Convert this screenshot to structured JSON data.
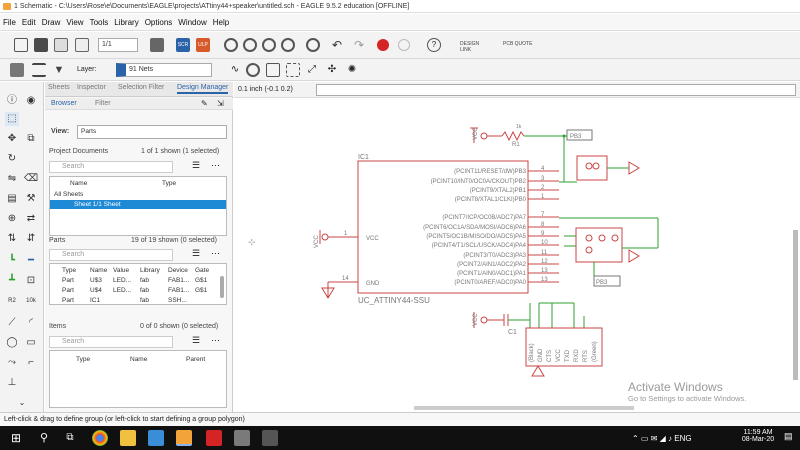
{
  "window": {
    "title": "1 Schematic - C:\\Users\\Rose\\e\\Documents\\EAGLE\\projects\\ATtiny44+speaker\\untitled.sch - EAGLE 9.5.2 education [OFFLINE]"
  },
  "menu": [
    "File",
    "Edit",
    "Draw",
    "View",
    "Tools",
    "Library",
    "Options",
    "Window",
    "Help"
  ],
  "toolbar": {
    "sheet_select": "1/1",
    "scr_label": "SCR",
    "ulp_label": "ULP",
    "design_link_label": "DESIGN LINK",
    "pcb_quote_label": "PCB QUOTE",
    "layer_label": "Layer:",
    "layer_value": "91 Nets"
  },
  "panel": {
    "tabs": [
      "Sheets",
      "Inspector",
      "Selection Filter",
      "Design Manager"
    ],
    "subtabs": [
      "Browser",
      "Filter"
    ],
    "view_label": "View:",
    "view_value": "Parts",
    "project_docs": {
      "title": "Project Documents",
      "count": "1 of 1 shown (1 selected)",
      "search_placeholder": "Search",
      "columns": [
        "Name",
        "Type"
      ],
      "items": [
        "All Sheets",
        "Sheet 1/1 Sheet"
      ]
    },
    "parts": {
      "title": "Parts",
      "count": "19 of 19 shown (0 selected)",
      "search_placeholder": "Search",
      "columns": [
        "Type",
        "Name",
        "Value",
        "Library",
        "Device",
        "Gate"
      ],
      "rows": [
        [
          "Part",
          "U$3",
          "LED...",
          "fab",
          "FAB1...",
          "G$1"
        ],
        [
          "Part",
          "U$4",
          "LED...",
          "fab",
          "FAB1...",
          "G$1"
        ],
        [
          "Part",
          "IC1",
          "",
          "fab",
          "SSH...",
          ""
        ]
      ]
    },
    "items": {
      "title": "Items",
      "count": "0 of 0 shown (0 selected)",
      "search_placeholder": "Search",
      "columns": [
        "Type",
        "Name",
        "Parent"
      ]
    }
  },
  "command": {
    "coords": "0.1 inch (-0.1 0.2)"
  },
  "schematic": {
    "r1": {
      "name": "R1",
      "value": "1k"
    },
    "ic_name": "IC1",
    "ic_value": "UC_ATTINY44-SSU",
    "vcc": "VCC",
    "gnd": "GND",
    "c1": "C1",
    "pb3": "PB3",
    "pins_left": [
      "1",
      "14"
    ],
    "pins_left_names": [
      "VCC",
      "GND"
    ],
    "pins_right": [
      {
        "num": "4",
        "label": "(PCINT11/RESET/dW)PB3"
      },
      {
        "num": "3",
        "label": "(PCINT10/INT0/OC0A/CKOUT)PB2"
      },
      {
        "num": "2",
        "label": "(PCINT9/XTAL2)PB1"
      },
      {
        "num": "1",
        "label": "(PCINT8/XTAL1/CLKI)PB0"
      },
      {
        "num": "7",
        "label": "(PCINT7/ICP/OC0B/ADC7)PA7"
      },
      {
        "num": "8",
        "label": "(PCINT6/OC1A/SDA/MOSI/ADC6)PA6"
      },
      {
        "num": "9",
        "label": "(PCINT5/OC1B/MISO/DO/ADC5)PA5"
      },
      {
        "num": "10",
        "label": "(PCINT4/T1/SCL/USCK/ADC4)PA4"
      },
      {
        "num": "11",
        "label": "(PCINT3/T0/ADC3)PA3"
      },
      {
        "num": "12",
        "label": "(PCINT2/AIN1/ADC2)PA2"
      },
      {
        "num": "13",
        "label": "(PCINT1/AIN0/ADC1)PA1"
      },
      {
        "num": "13",
        "label": "(PCINT0/AREF/ADC0)PA0"
      }
    ],
    "ftdi_pins": [
      "(Black)",
      "GND",
      "CTS",
      "VCC",
      "TXD",
      "RXD",
      "RTS",
      "(Green)"
    ]
  },
  "status": "Left-click & drag to define group (or left-click to start defining a group polygon)",
  "watermark": {
    "line1": "Activate Windows",
    "line2": "Go to Settings to activate Windows."
  },
  "taskbar": {
    "time": "11:59 AM",
    "date": "08-Mar-20"
  }
}
